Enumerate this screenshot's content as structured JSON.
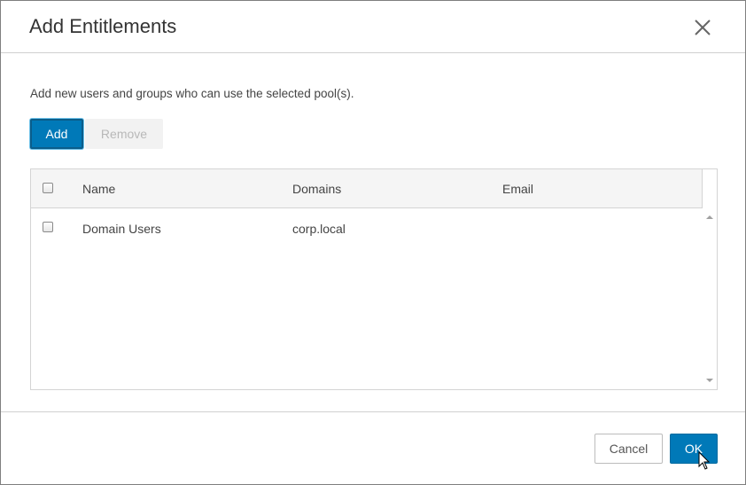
{
  "dialog": {
    "title": "Add Entitlements",
    "description": "Add new users and groups who can use the selected pool(s).",
    "close_icon": "close-icon"
  },
  "toolbar": {
    "add_label": "Add",
    "remove_label": "Remove"
  },
  "table": {
    "columns": [
      "Name",
      "Domains",
      "Email"
    ],
    "rows": [
      {
        "name": "Domain Users",
        "domain": "corp.local",
        "email": ""
      }
    ]
  },
  "footer": {
    "cancel_label": "Cancel",
    "ok_label": "OK"
  },
  "colors": {
    "primary": "#0079b8",
    "border": "#d4d4d4"
  }
}
